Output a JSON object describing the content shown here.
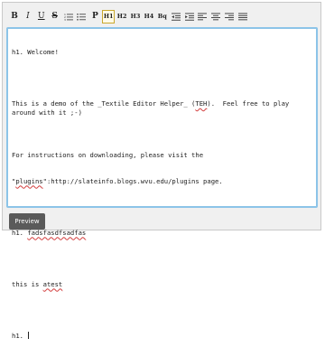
{
  "toolbar": {
    "buttons": [
      {
        "name": "bold-button",
        "label": "B",
        "icon": "bold-icon"
      },
      {
        "name": "italic-button",
        "label": "I",
        "icon": "italic-icon"
      },
      {
        "name": "underline-button",
        "label": "U",
        "icon": "underline-icon"
      },
      {
        "name": "strikethrough-button",
        "label": "S",
        "icon": "strikethrough-icon"
      },
      {
        "name": "ordered-list-button",
        "label": "",
        "icon": "ordered-list-icon"
      },
      {
        "name": "unordered-list-button",
        "label": "",
        "icon": "unordered-list-icon"
      },
      {
        "name": "paragraph-button",
        "label": "P",
        "icon": "paragraph-icon"
      },
      {
        "name": "h1-button",
        "label": "H1",
        "icon": "heading-1-icon",
        "active": true
      },
      {
        "name": "h2-button",
        "label": "H2",
        "icon": "heading-2-icon"
      },
      {
        "name": "h3-button",
        "label": "H3",
        "icon": "heading-3-icon"
      },
      {
        "name": "h4-button",
        "label": "H4",
        "icon": "heading-4-icon"
      },
      {
        "name": "blockquote-button",
        "label": "Bq",
        "icon": "blockquote-icon"
      },
      {
        "name": "outdent-button",
        "label": "",
        "icon": "outdent-icon"
      },
      {
        "name": "indent-button",
        "label": "",
        "icon": "indent-icon"
      },
      {
        "name": "align-left-button",
        "label": "",
        "icon": "align-left-icon"
      },
      {
        "name": "align-center-button",
        "label": "",
        "icon": "align-center-icon"
      },
      {
        "name": "align-right-button",
        "label": "",
        "icon": "align-right-icon"
      },
      {
        "name": "justify-button",
        "label": "",
        "icon": "justify-icon"
      }
    ]
  },
  "editor": {
    "line1": "h1. Welcome!",
    "line2a": "This is a demo of the _Textile Editor Helper_ (",
    "line2b": "TEH",
    "line2c": ").  Feel free to play around with it ;-)",
    "line3": "For instructions on downloading, please visit the",
    "line4a": "\"",
    "line4b": "plugins",
    "line4c": "\":http://slateinfo.blogs.wvu.edu/plugins page.",
    "line5a": "h1. ",
    "line5b": "fadsfasdfsadfas",
    "line6a": "this is ",
    "line6b": "atest",
    "line7": "h1. "
  },
  "preview_label": "Preview",
  "colors": {
    "accent_border": "#8cc4e8",
    "preview_bg": "#5a5a5a",
    "active_button_border": "#c9a82e",
    "spellcheck": "#d23c3c"
  }
}
